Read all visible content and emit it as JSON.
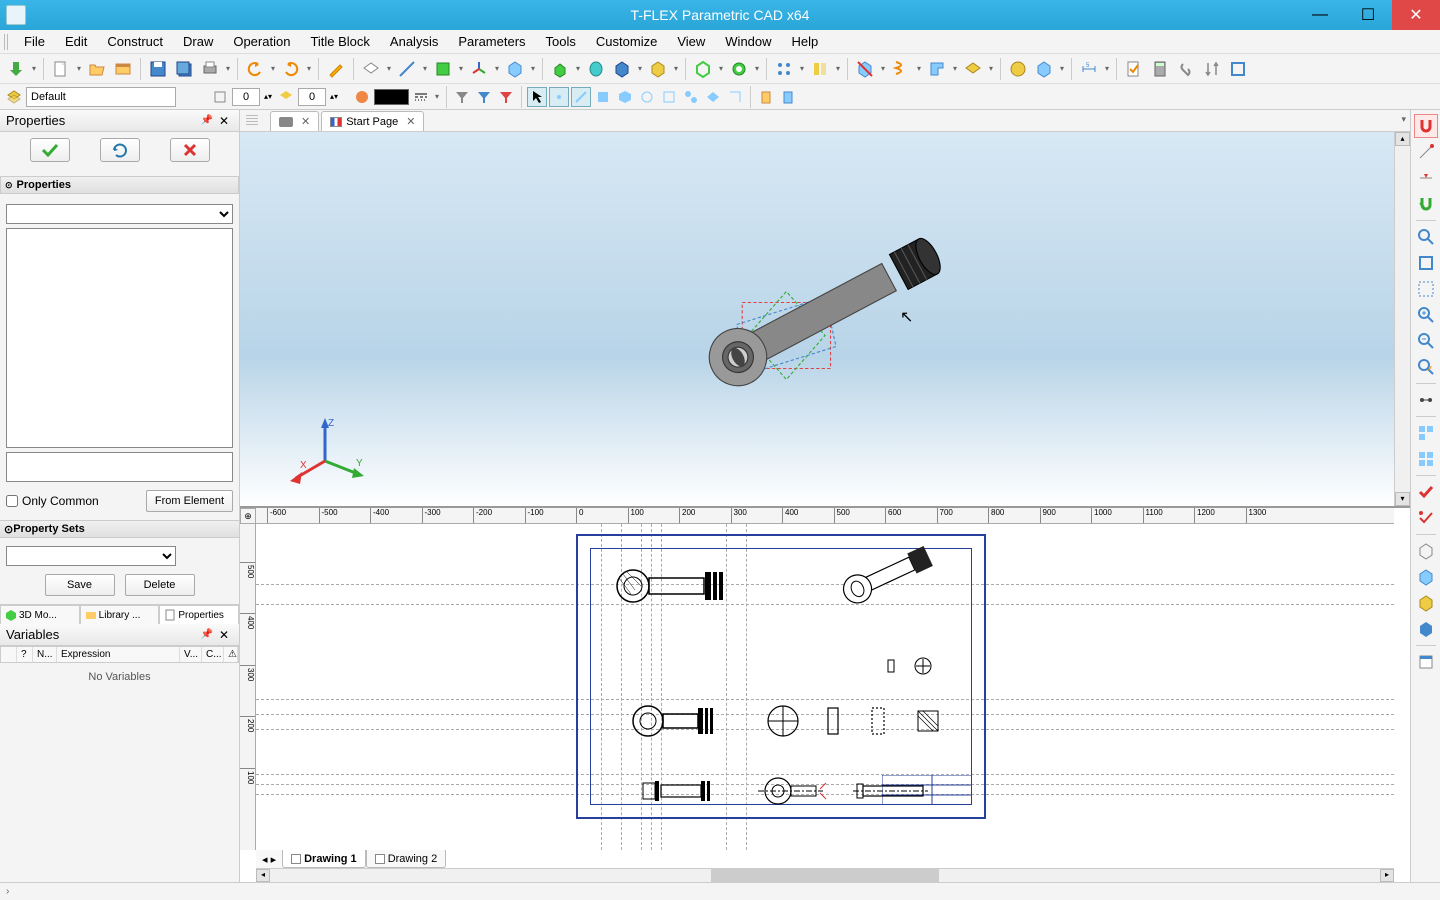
{
  "window": {
    "title": "T-FLEX Parametric CAD x64"
  },
  "menu": [
    "File",
    "Edit",
    "Construct",
    "Draw",
    "Operation",
    "Title Block",
    "Analysis",
    "Parameters",
    "Tools",
    "Customize",
    "View",
    "Window",
    "Help"
  ],
  "toolbar2": {
    "layer_label": "Default",
    "level1": "0",
    "level2": "0"
  },
  "doc_tabs": [
    {
      "label": "",
      "has_close": true,
      "kind": "part"
    },
    {
      "label": "Start Page",
      "has_close": true,
      "kind": "flag"
    }
  ],
  "properties_panel": {
    "title": "Properties",
    "subsection": "Properties",
    "only_common": "Only Common",
    "from_element": "From Element",
    "property_sets": "Property Sets",
    "save": "Save",
    "delete": "Delete"
  },
  "left_tabs": [
    "3D Mo...",
    "Library ...",
    "Properties"
  ],
  "variables_panel": {
    "title": "Variables",
    "columns": [
      "",
      "?",
      "N...",
      "Expression",
      "V...",
      "C..."
    ],
    "empty_text": "No Variables"
  },
  "ruler_h": [
    -600,
    -500,
    -400,
    -300,
    -200,
    -100,
    0,
    100,
    200,
    300,
    400,
    500,
    600,
    700,
    800,
    900,
    1000,
    1100,
    1200,
    1300
  ],
  "ruler_v": [
    500,
    400,
    300,
    200,
    100
  ],
  "page_tabs": [
    {
      "label": "Drawing 1",
      "active": true
    },
    {
      "label": "Drawing 2",
      "active": false
    }
  ],
  "triad": {
    "x": "X",
    "y": "Y",
    "z": "Z"
  }
}
